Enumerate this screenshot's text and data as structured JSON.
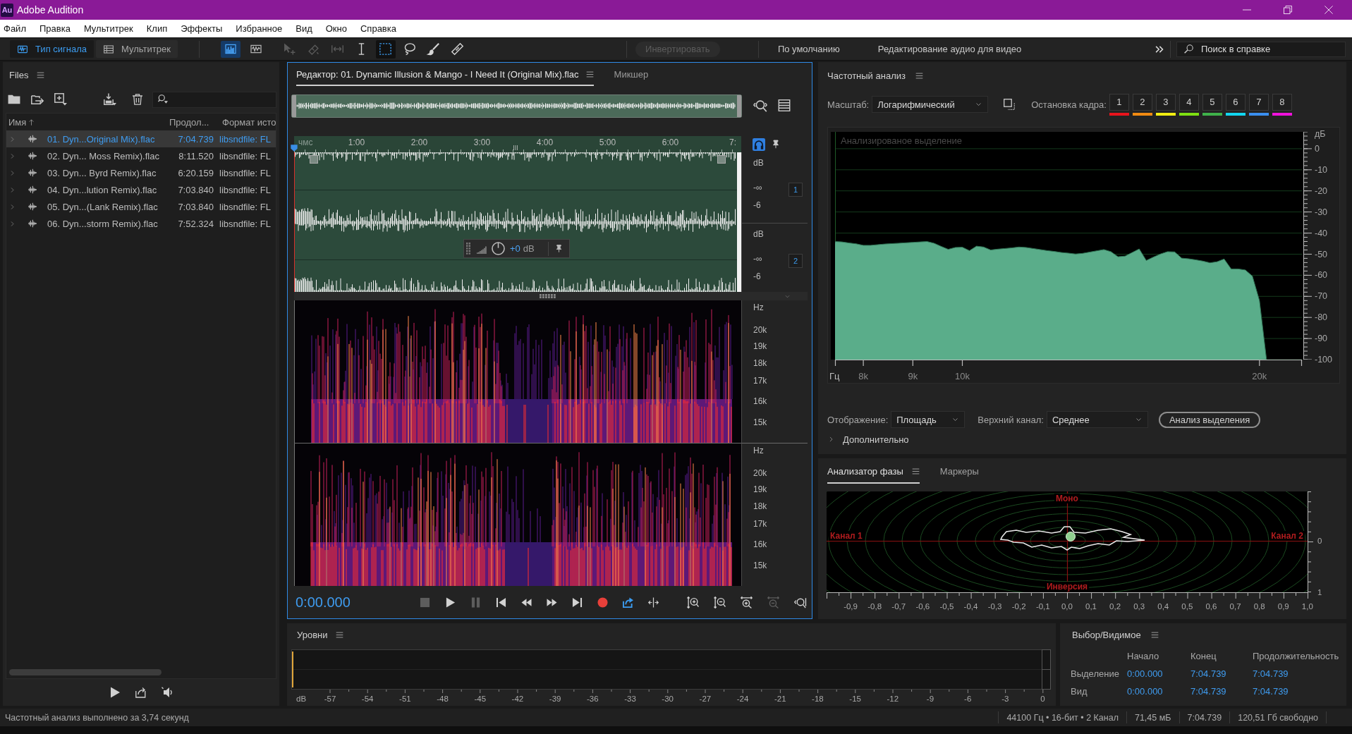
{
  "window": {
    "logo": "Au",
    "title": "Adobe Audition"
  },
  "menu": [
    "Файл",
    "Правка",
    "Мультитрек",
    "Клип",
    "Эффекты",
    "Избранное",
    "Вид",
    "Окно",
    "Справка"
  ],
  "toolbar": {
    "modes": [
      {
        "kind": "waveform",
        "label": "Тип сигнала",
        "selected": true
      },
      {
        "kind": "multitrack",
        "label": "Мультитрек",
        "selected": false
      }
    ],
    "views": [
      {
        "kind": "spectral",
        "selected": true
      },
      {
        "kind": "waveform",
        "selected": false
      }
    ],
    "tools": [
      {
        "kind": "move",
        "disabled": true,
        "selected": false
      },
      {
        "kind": "razor",
        "disabled": true,
        "selected": false
      },
      {
        "kind": "slip",
        "disabled": true,
        "selected": false
      },
      {
        "kind": "time-selection",
        "disabled": false,
        "selected": false
      },
      {
        "kind": "marquee",
        "disabled": false,
        "selected": true
      },
      {
        "kind": "lasso",
        "disabled": false,
        "selected": false
      },
      {
        "kind": "brush",
        "disabled": false,
        "selected": false
      },
      {
        "kind": "heal",
        "disabled": false,
        "selected": false
      }
    ],
    "invert": {
      "label": "Инвертировать",
      "disabled": true
    },
    "workspaces": [
      "По умолчанию",
      "Редактирование аудио для видео"
    ],
    "help_search": {
      "placeholder": "Поиск в справке"
    }
  },
  "files": {
    "title": "Files",
    "columns": [
      {
        "label": "Имя",
        "sorted": true
      },
      {
        "label": "Продол...",
        "sorted": false
      },
      {
        "label": "Формат исто",
        "sorted": false
      }
    ],
    "rows": [
      {
        "name": "01. Dyn...Original Mix).flac",
        "duration": "7:04.739",
        "format": "libsndfile: FL",
        "selected": true,
        "expanded": false
      },
      {
        "name": "02. Dyn... Moss Remix).flac",
        "duration": "8:11.520",
        "format": "libsndfile: FL",
        "selected": false,
        "expanded": false
      },
      {
        "name": "03. Dyn... Byrd Remix).flac",
        "duration": "6:20.159",
        "format": "libsndfile: FL",
        "selected": false,
        "expanded": false
      },
      {
        "name": "04. Dyn...lution Remix).flac",
        "duration": "7:03.840",
        "format": "libsndfile: FL",
        "selected": false,
        "expanded": false
      },
      {
        "name": "05. Dyn...(Lank Remix).flac",
        "duration": "7:03.840",
        "format": "libsndfile: FL",
        "selected": false,
        "expanded": false
      },
      {
        "name": "06. Dyn...storm Remix).flac",
        "duration": "7:52.324",
        "format": "libsndfile: FL",
        "selected": false,
        "expanded": false
      }
    ]
  },
  "editor": {
    "tabs": [
      {
        "label": "Редактор: 01. Dynamic Illusion & Mango - I Need It (Original Mix).flac",
        "selected": true
      },
      {
        "label": "Микшер",
        "selected": false
      }
    ],
    "ruler": [
      "чмс",
      "1:00",
      "2:00",
      "3:00",
      "4:00",
      "5:00",
      "6:00",
      "7:"
    ],
    "channels": [
      {
        "number": "1",
        "scale": [
          "dB",
          "-∞",
          "-6"
        ]
      },
      {
        "number": "2",
        "scale": [
          "dB",
          "-∞",
          "-6"
        ],
        "gain_hud": {
          "value": "+0",
          "unit": "dB"
        }
      }
    ],
    "spectral_channels": [
      {
        "scale": [
          "Hz",
          "20k",
          "19k",
          "18k",
          "17k",
          "16k",
          "15k"
        ]
      },
      {
        "scale": [
          "Hz",
          "20k",
          "19k",
          "18k",
          "17k",
          "16k",
          "15k"
        ]
      }
    ],
    "time": "0:00.000",
    "transport": [
      {
        "kind": "stop",
        "disabled": true,
        "on": false
      },
      {
        "kind": "play",
        "disabled": false,
        "on": false
      },
      {
        "kind": "pause",
        "disabled": true,
        "on": false
      },
      {
        "kind": "skip-start",
        "disabled": false,
        "on": false
      },
      {
        "kind": "rewind",
        "disabled": false,
        "on": false
      },
      {
        "kind": "fast-forward",
        "disabled": false,
        "on": false
      },
      {
        "kind": "skip-end",
        "disabled": false,
        "on": false
      },
      {
        "kind": "record",
        "disabled": false,
        "on": false
      },
      {
        "kind": "loop",
        "disabled": false,
        "on": true
      },
      {
        "kind": "skip-selection",
        "disabled": false,
        "on": false
      }
    ],
    "zoom_controls": [
      {
        "kind": "zoom-in-amplitude",
        "disabled": false
      },
      {
        "kind": "zoom-out-amplitude",
        "disabled": false
      },
      {
        "kind": "zoom-in-time",
        "disabled": false
      },
      {
        "kind": "zoom-out-time",
        "disabled": true
      },
      {
        "kind": "zoom-full",
        "disabled": false
      }
    ]
  },
  "frequency_analysis": {
    "title": "Частотный анализ",
    "scale_label": "Масштаб:",
    "scale_value": "Логарифмический",
    "freeze_label": "Остановка кадра:",
    "freeze_slots": [
      {
        "label": "1",
        "color": "#e8141c"
      },
      {
        "label": "2",
        "color": "#f28a12"
      },
      {
        "label": "3",
        "color": "#f2ee12"
      },
      {
        "label": "4",
        "color": "#7ee012"
      },
      {
        "label": "5",
        "color": "#3fb24a"
      },
      {
        "label": "6",
        "color": "#12d6f0"
      },
      {
        "label": "7",
        "color": "#3a8ff0"
      },
      {
        "label": "8",
        "color": "#f012dc"
      }
    ],
    "chart_data": {
      "type": "area",
      "title": "Анализированое выделение",
      "xlabel": "Гц",
      "ylabel": "дБ",
      "categories": [
        null,
        null,
        null,
        null,
        "8k",
        null,
        null,
        null,
        null,
        null,
        null,
        "9k",
        null,
        null,
        null,
        null,
        null,
        null,
        "10k",
        null,
        null,
        null,
        null,
        null,
        null,
        null,
        null,
        null,
        null,
        null,
        null,
        null,
        null,
        null,
        null,
        null,
        null,
        null,
        null,
        null,
        null,
        null,
        null,
        null,
        null,
        null,
        null,
        null,
        null,
        null,
        null,
        null,
        null,
        null,
        null,
        null,
        null,
        null,
        null,
        null,
        "20k",
        null,
        null,
        null,
        null,
        null,
        null
      ],
      "series": [
        {
          "color": "#5aad8a",
          "values": [
            -44,
            -44.2,
            -44.7,
            -45.1,
            -45.8,
            -45.8,
            -45.5,
            -45.2,
            -45,
            -44.8,
            -44.6,
            -44.4,
            -44.2,
            -44,
            -44.8,
            -46.3,
            -47.7,
            -46.8,
            -46.7,
            -48.3,
            -46.2,
            -46.6,
            -48,
            -47.6,
            -47.3,
            -47,
            -46.6,
            -46.8,
            -47.3,
            -47.8,
            -48.3,
            -48.7,
            -49.2,
            -49.5,
            -49.9,
            -49.6,
            -49,
            -48.4,
            -47.8,
            -48.8,
            -51.2,
            -50.9,
            -49.2,
            -47.5,
            -53,
            -51.4,
            -49.9,
            -48.8,
            -48.9,
            -51.9,
            -52.2,
            -52.7,
            -53.3,
            -54.1,
            -53.6,
            -52.3,
            -57,
            -57,
            -57.5,
            -60.4,
            -72,
            -100,
            null,
            null,
            null,
            null,
            null
          ]
        }
      ],
      "ylim": [
        -100,
        8
      ],
      "yticks": [
        0,
        -10,
        -20,
        -30,
        -40,
        -50,
        -60,
        -70,
        -80,
        -90,
        -100
      ],
      "grid": true
    },
    "display_label": "Отображение:",
    "display_value": "Площадь",
    "channel_label": "Верхний канал:",
    "channel_value": "Среднее",
    "analyze_button": "Анализ выделения",
    "advanced": {
      "label": "Дополнительно",
      "expanded": false
    }
  },
  "phase_analyzer": {
    "tabs": [
      {
        "label": "Анализатор фазы",
        "selected": true
      },
      {
        "label": "Маркеры",
        "selected": false
      }
    ],
    "top_label": "Моно",
    "left_label": "Канал 1",
    "right_label": "Канал 2",
    "bottom_label": "Инверсия",
    "x_ticks": [
      "-0,9",
      "-0,8",
      "-0,7",
      "-0,6",
      "-0,5",
      "-0,4",
      "-0,3",
      "-0,2",
      "-0,1",
      "0,0",
      "0,1",
      "0,2",
      "0,3",
      "0,4",
      "0,5",
      "0,6",
      "0,7",
      "0,8",
      "0,9",
      "1,0"
    ],
    "y_ticks": [
      "0",
      "1"
    ]
  },
  "levels": {
    "title": "Уровни",
    "unit": "dB",
    "scale": [
      "-57",
      "-54",
      "-51",
      "-48",
      "-45",
      "-42",
      "-39",
      "-36",
      "-33",
      "-30",
      "-27",
      "-24",
      "-21",
      "-18",
      "-15",
      "-12",
      "-9",
      "-6",
      "-3",
      "0"
    ]
  },
  "selection_view": {
    "title": "Выбор/Видимое",
    "columns": [
      "Начало",
      "Конец",
      "Продолжительность"
    ],
    "rows": [
      {
        "label": "Выделение",
        "start": "0:00.000",
        "end": "7:04.739",
        "duration": "7:04.739"
      },
      {
        "label": "Вид",
        "start": "0:00.000",
        "end": "7:04.739",
        "duration": "7:04.739"
      }
    ]
  },
  "status_bar": {
    "message": "Частотный анализ выполнено за 3,74 секунд",
    "format": "44100 Гц • 16-бит • 2 Канал",
    "size": "71,45 мБ",
    "duration": "7:04.739",
    "free": "120,51 Гб свободно"
  }
}
